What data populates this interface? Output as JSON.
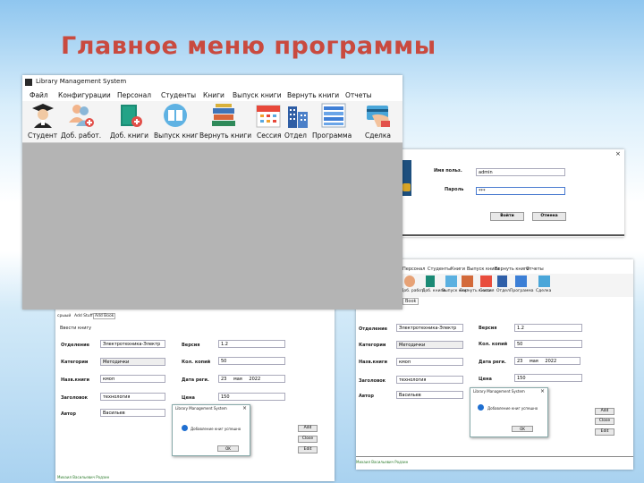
{
  "slide_title": "Главное меню программы",
  "main_window": {
    "title": "Library Management System",
    "menu": [
      "Файл",
      "Конфигурации",
      "Персонал",
      "Студенты",
      "Книги",
      "Выпуск книги",
      "Вернуть книги",
      "Отчеты"
    ],
    "toolbar": [
      "Студент",
      "Доб. работ.",
      "Доб. книги",
      "Выпуск книг",
      "Вернуть книги",
      "Сессия",
      "Отдел",
      "Программа",
      "Сделка"
    ]
  },
  "login_window": {
    "username_label": "Имя польз.",
    "username_value": "admin",
    "password_label": "Пароль",
    "password_value": "***",
    "login_button": "Войти",
    "cancel_button": "Отмена",
    "close_glyph": "×"
  },
  "left_form": {
    "tabs": [
      "срыый",
      "Add Stuff",
      "Add Book"
    ],
    "section_title": "Ввести книгу",
    "department_label": "Отделение",
    "department_value": "Электротехника-Электр",
    "category_label": "Категории",
    "category_value": "Методички",
    "title_label": "Назв.книги",
    "title_value": "кмоп",
    "heading_label": "Заголовок",
    "heading_value": "технология",
    "author_label": "Автор",
    "author_value": "Васильев",
    "version_label": "Версия",
    "version_value": "1.2",
    "copies_label": "Кол. копий",
    "copies_value": "50",
    "date_label": "Дата реги.",
    "date_day": "23",
    "date_month": "мая",
    "date_year": "2022",
    "price_label": "Цена",
    "price_value": "150",
    "buttons": [
      "Add",
      "Close",
      "Edit"
    ],
    "footer": "Михаил Васильевич Родзин"
  },
  "left_message": {
    "title": "Library Management System",
    "text": "Добавление книг успешно",
    "ok": "OK",
    "close_glyph": "×"
  },
  "right_window": {
    "menu": [
      "Персонал",
      "Студенты",
      "Книги",
      "Выпуск книги",
      "Вернуть книги",
      "Отчеты"
    ],
    "toolbar": [
      "Доб. работ.",
      "Доб. книги",
      "Выпуск книг",
      "Вернуть книги",
      "Сессия",
      "Отдел",
      "Программа",
      "Сделка"
    ],
    "tab": "Book",
    "department_label": "Отделение",
    "department_value": "Электротехника-Электр",
    "category_label": "Категории",
    "category_value": "Методички",
    "title_label": "Назв.книги",
    "title_value": "кмоп",
    "heading_label": "Заголовок",
    "heading_value": "технология",
    "author_label": "Автор",
    "author_value": "Васильев",
    "version_label": "Версия",
    "version_value": "1.2",
    "copies_label": "Кол. копий",
    "copies_value": "50",
    "date_label": "Дата реги.",
    "date_day": "23",
    "date_month": "мая",
    "date_year": "2022",
    "price_label": "Цена",
    "price_value": "150",
    "buttons": [
      "Add",
      "Close",
      "Edit"
    ],
    "footer": "Михаил Васильевич Родзин"
  },
  "right_message": {
    "title": "Library Management System",
    "text": "Добавление книг успешно",
    "ok": "OK",
    "close_glyph": "×"
  },
  "colors": {
    "title_red": "#c94a3f",
    "workspace_gray": "#b4b4b4"
  }
}
